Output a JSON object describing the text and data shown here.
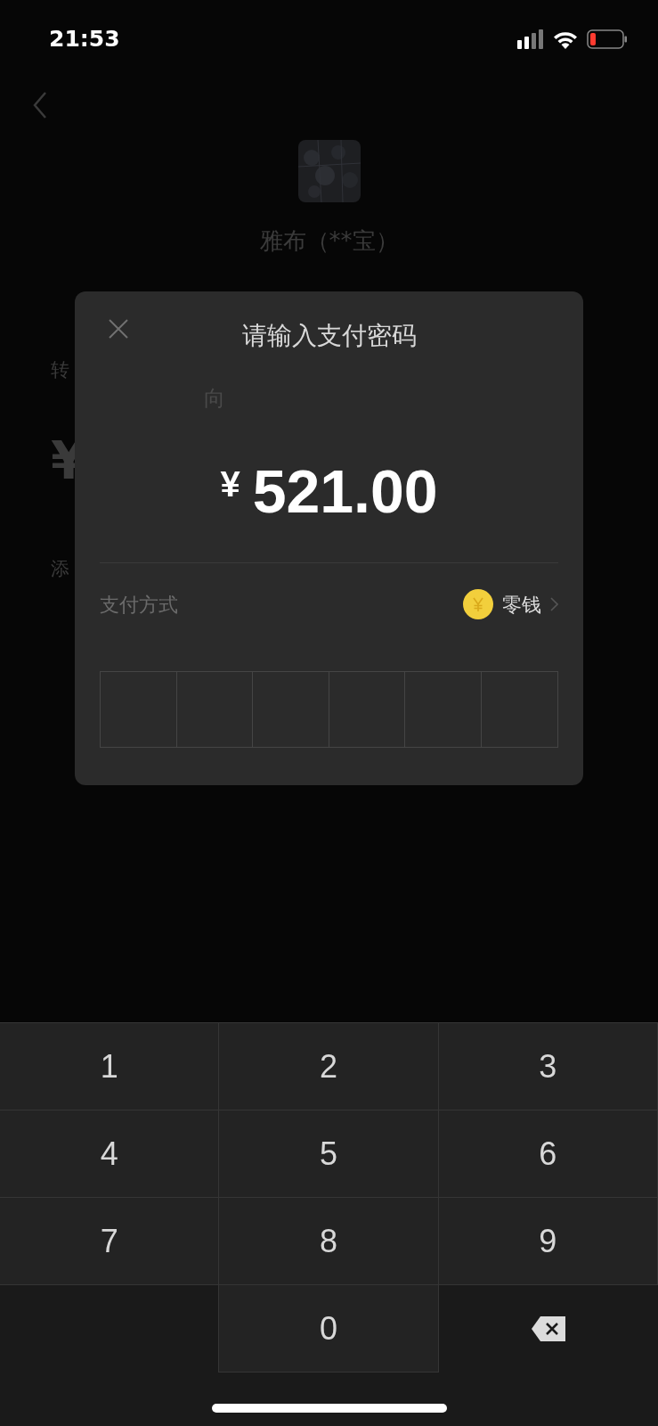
{
  "status_bar": {
    "time": "21:53"
  },
  "background_page": {
    "payee": "雅布（**宝）",
    "partial_labels": [
      "转",
      "¥",
      "添"
    ]
  },
  "dialog": {
    "title": "请输入支付密码",
    "note_fragment": "向",
    "currency": "¥",
    "amount": "521.00",
    "payment_method": {
      "label": "支付方式",
      "value": "零钱"
    },
    "password_boxes": [
      {
        "filled": false
      },
      {
        "filled": false
      },
      {
        "filled": false
      },
      {
        "filled": false
      },
      {
        "filled": false
      },
      {
        "filled": false
      }
    ]
  },
  "keypad": [
    {
      "kind": "digit",
      "label": "1"
    },
    {
      "kind": "digit",
      "label": "2"
    },
    {
      "kind": "digit",
      "label": "3"
    },
    {
      "kind": "digit",
      "label": "4"
    },
    {
      "kind": "digit",
      "label": "5"
    },
    {
      "kind": "digit",
      "label": "6"
    },
    {
      "kind": "digit",
      "label": "7"
    },
    {
      "kind": "digit",
      "label": "8"
    },
    {
      "kind": "digit",
      "label": "9"
    },
    {
      "kind": "blank"
    },
    {
      "kind": "digit",
      "label": "0"
    },
    {
      "kind": "backspace"
    }
  ]
}
